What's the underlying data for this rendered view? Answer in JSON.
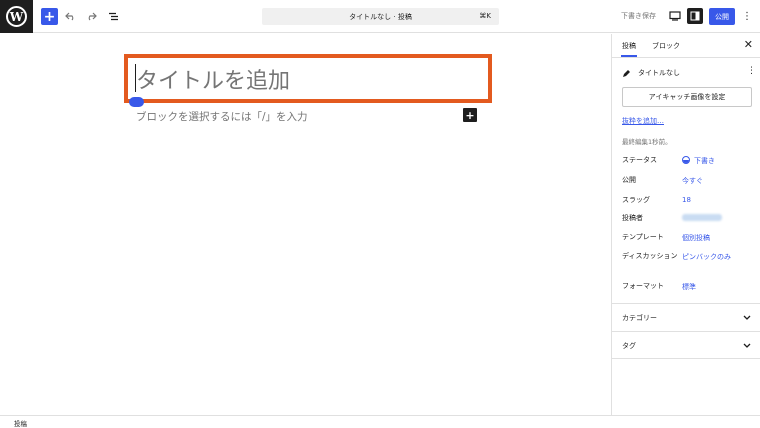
{
  "toolbar": {
    "logo": "W",
    "add_block": "+",
    "command_title": "タイトルなし · 投稿",
    "command_shortcut": "⌘K",
    "save_draft": "下書き保存",
    "publish": "公開",
    "options": "⋮"
  },
  "editor": {
    "title_placeholder": "タイトルを追加",
    "block_placeholder": "ブロックを選択するには「/」を入力",
    "inserter": "+"
  },
  "sidebar": {
    "tabs": [
      "投稿",
      "ブロック"
    ],
    "close": "✕",
    "post_title": "タイトルなし",
    "post_options": "⋮",
    "featured_image_button": "アイキャッチ画像を設定",
    "excerpt_link": "抜粋を追加…",
    "last_edited": "最終編集1秒前。",
    "meta": [
      {
        "label": "ステータス",
        "value": "下書き"
      },
      {
        "label": "公開",
        "value": "今すぐ"
      },
      {
        "label": "スラッグ",
        "value": "18"
      },
      {
        "label": "投稿者",
        "value": ""
      },
      {
        "label": "テンプレート",
        "value": "個別投稿"
      },
      {
        "label": "ディスカッション",
        "value": "ピンバックのみ"
      },
      {
        "label": "フォーマット",
        "value": "標準"
      }
    ],
    "panels": [
      "カテゴリー",
      "タグ"
    ]
  },
  "footer": {
    "breadcrumb": "投稿"
  },
  "colors": {
    "accent": "#3858e9",
    "highlight": "#e35a1f",
    "dark": "#1e1e1e"
  }
}
